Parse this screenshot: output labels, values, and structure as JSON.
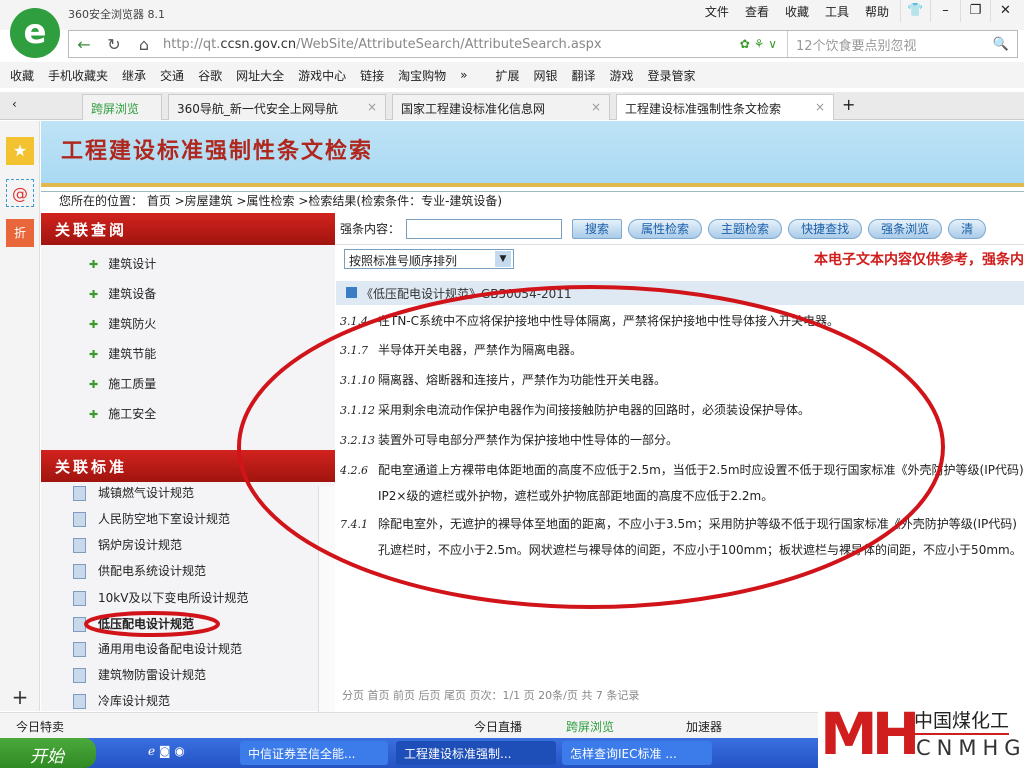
{
  "browser": {
    "title": "360安全浏览器 8.1",
    "menus": [
      "文件",
      "查看",
      "收藏",
      "工具",
      "帮助"
    ],
    "url_prefix": "http://qt.",
    "url_domain": "ccsn.gov.cn",
    "url_path": "/WebSite/AttributeSearch/AttributeSearch.aspx",
    "search_placeholder": "12个饮食要点别忽视",
    "favorites": [
      "收藏",
      "手机收藏夹",
      "继承",
      "交通",
      "谷歌",
      "网址大全",
      "游戏中心",
      "链接",
      "淘宝购物",
      "扩展",
      "网银",
      "翻译",
      "游戏",
      "登录管家"
    ],
    "tabs": [
      "跨屏浏览",
      "360导航_新一代安全上网导航",
      "国家工程建设标准化信息网",
      "工程建设标准强制性条文检索"
    ]
  },
  "page": {
    "title": "工程建设标准强制性条文检索",
    "breadcrumb": "您所在的位置： 首页 >房屋建筑 >属性检索 >检索结果(检索条件：专业-建筑设备)",
    "related_query": "关联查阅",
    "categories": [
      "建筑设计",
      "建筑设备",
      "建筑防火",
      "建筑节能",
      "施工质量",
      "施工安全"
    ],
    "related_standards": "关联标准",
    "standards": [
      "城镇燃气设计规范",
      "人民防空地下室设计规范",
      "锅炉房设计规范",
      "供配电系统设计规范",
      "10kV及以下变电所设计规范",
      "低压配电设计规范",
      "通用用电设备配电设计规范",
      "建筑物防雷设计规范",
      "冷库设计规范"
    ],
    "search_label": "强条内容：",
    "search_value": "",
    "buttons": [
      "搜索",
      "属性检索",
      "主题检索",
      "快捷查找",
      "强条浏览",
      "清"
    ],
    "sort": "按照标准号顺序排列",
    "notice": "本电子文本内容仅供参考，强条内",
    "standard_header": "《低压配电设计规范》GB50054-2011",
    "clauses": [
      {
        "num": "3.1.4",
        "lines": [
          "在TN-C系统中不应将保护接地中性导体隔离，严禁将保护接地中性导体接入开关电器。"
        ]
      },
      {
        "num": "3.1.7",
        "lines": [
          "半导体开关电器，严禁作为隔离电器。"
        ]
      },
      {
        "num": "3.1.10",
        "lines": [
          "隔离器、熔断器和连接片，严禁作为功能性开关电器。"
        ]
      },
      {
        "num": "3.1.12",
        "lines": [
          "采用剩余电流动作保护电器作为间接接触防护电器的回路时，必须装设保护导体。"
        ]
      },
      {
        "num": "3.2.13",
        "lines": [
          "装置外可导电部分严禁作为保护接地中性导体的一部分。"
        ]
      },
      {
        "num": "4.2.6",
        "lines": [
          "配电室通道上方裸带电体距地面的高度不应低于2.5m，当低于2.5m时应设置不低于现行国家标准《外壳防护等级(IP代码)",
          "IP2×级的遮栏或外护物，遮栏或外护物底部距地面的高度不应低于2.2m。"
        ]
      },
      {
        "num": "7.4.1",
        "lines": [
          "除配电室外，无遮护的裸导体至地面的距离，不应小于3.5m；采用防护等级不低于现行国家标准《外壳防护等级(IP代码)",
          "孔遮栏时，不应小于2.5m。网状遮栏与裸导体的间距，不应小于100mm；板状遮栏与裸导体的间距，不应小于50mm。"
        ]
      }
    ],
    "pager": "分页  首页  前页  后页  尾页                                              页次：1/1  页  20条/页  共  7  条记录"
  },
  "statusbar": {
    "left": "今日特卖",
    "items": [
      "今日直播",
      "跨屏浏览",
      "加速器"
    ]
  },
  "taskbar": {
    "start": "开始",
    "tasks": [
      "中信证券至信全能...",
      "工程建设标准强制...",
      "怎样查询IEC标准 ..."
    ]
  },
  "watermark": {
    "cn": "中国煤化工",
    "en": "CNMHG"
  }
}
